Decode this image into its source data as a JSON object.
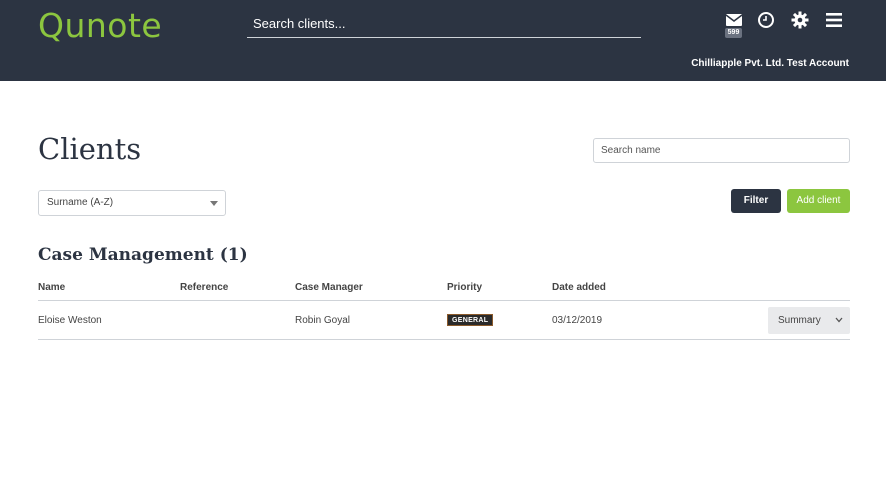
{
  "header": {
    "logo_text": "Qunote",
    "search_placeholder": "Search clients...",
    "mail_count": "599",
    "account_name": "Chilliapple Pvt. Ltd. Test Account",
    "icons": [
      "mail-icon",
      "clock-icon",
      "gear-icon",
      "menu-icon"
    ]
  },
  "page": {
    "title": "Clients",
    "search_name_placeholder": "Search name",
    "sort_value": "Surname (A-Z)",
    "filter_label": "Filter",
    "add_client_label": "Add client"
  },
  "section": {
    "title": "Case Management (1)",
    "columns": [
      "Name",
      "Reference",
      "Case Manager",
      "Priority",
      "Date added"
    ],
    "rows": [
      {
        "name": "Eloise Weston",
        "reference": "",
        "case_manager": "Robin Goyal",
        "priority": "GENERAL",
        "date_added": "03/12/2019",
        "action": "Summary"
      }
    ]
  },
  "colors": {
    "header_bg": "#2c3442",
    "brand_green": "#8cc63f",
    "filter_bg": "#2c3442"
  }
}
